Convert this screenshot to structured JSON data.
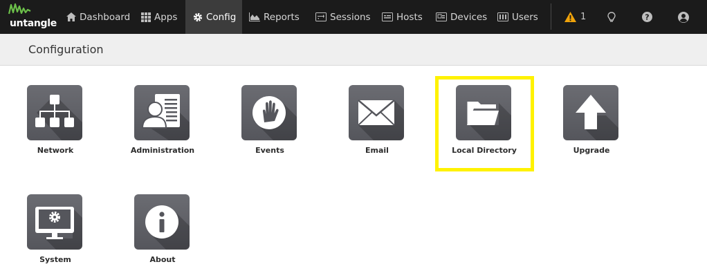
{
  "app": {
    "logo_text": "untangle",
    "brand_color": "#6cc04a"
  },
  "nav": {
    "items": [
      {
        "label": "Dashboard",
        "icon": "home-icon"
      },
      {
        "label": "Apps",
        "icon": "grid-icon"
      },
      {
        "label": "Config",
        "icon": "gear-icon",
        "active": true
      },
      {
        "label": "Reports",
        "icon": "area-chart-icon"
      },
      {
        "label": "Sessions",
        "icon": "sessions-icon"
      },
      {
        "label": "Hosts",
        "icon": "hosts-icon"
      },
      {
        "label": "Devices",
        "icon": "devices-icon"
      },
      {
        "label": "Users",
        "icon": "users-icon"
      }
    ],
    "alerts_count": "1",
    "alert_color": "#f0a30a"
  },
  "page": {
    "title": "Configuration"
  },
  "tiles": [
    {
      "label": "Network",
      "icon": "network-icon"
    },
    {
      "label": "Administration",
      "icon": "administration-icon"
    },
    {
      "label": "Events",
      "icon": "events-hand-icon"
    },
    {
      "label": "Email",
      "icon": "envelope-icon"
    },
    {
      "label": "Local Directory",
      "icon": "folder-open-icon"
    },
    {
      "label": "Upgrade",
      "icon": "upgrade-arrow-icon"
    },
    {
      "label": "System",
      "icon": "system-monitor-icon"
    },
    {
      "label": "About",
      "icon": "info-icon"
    }
  ],
  "highlight_color": "#fff200"
}
